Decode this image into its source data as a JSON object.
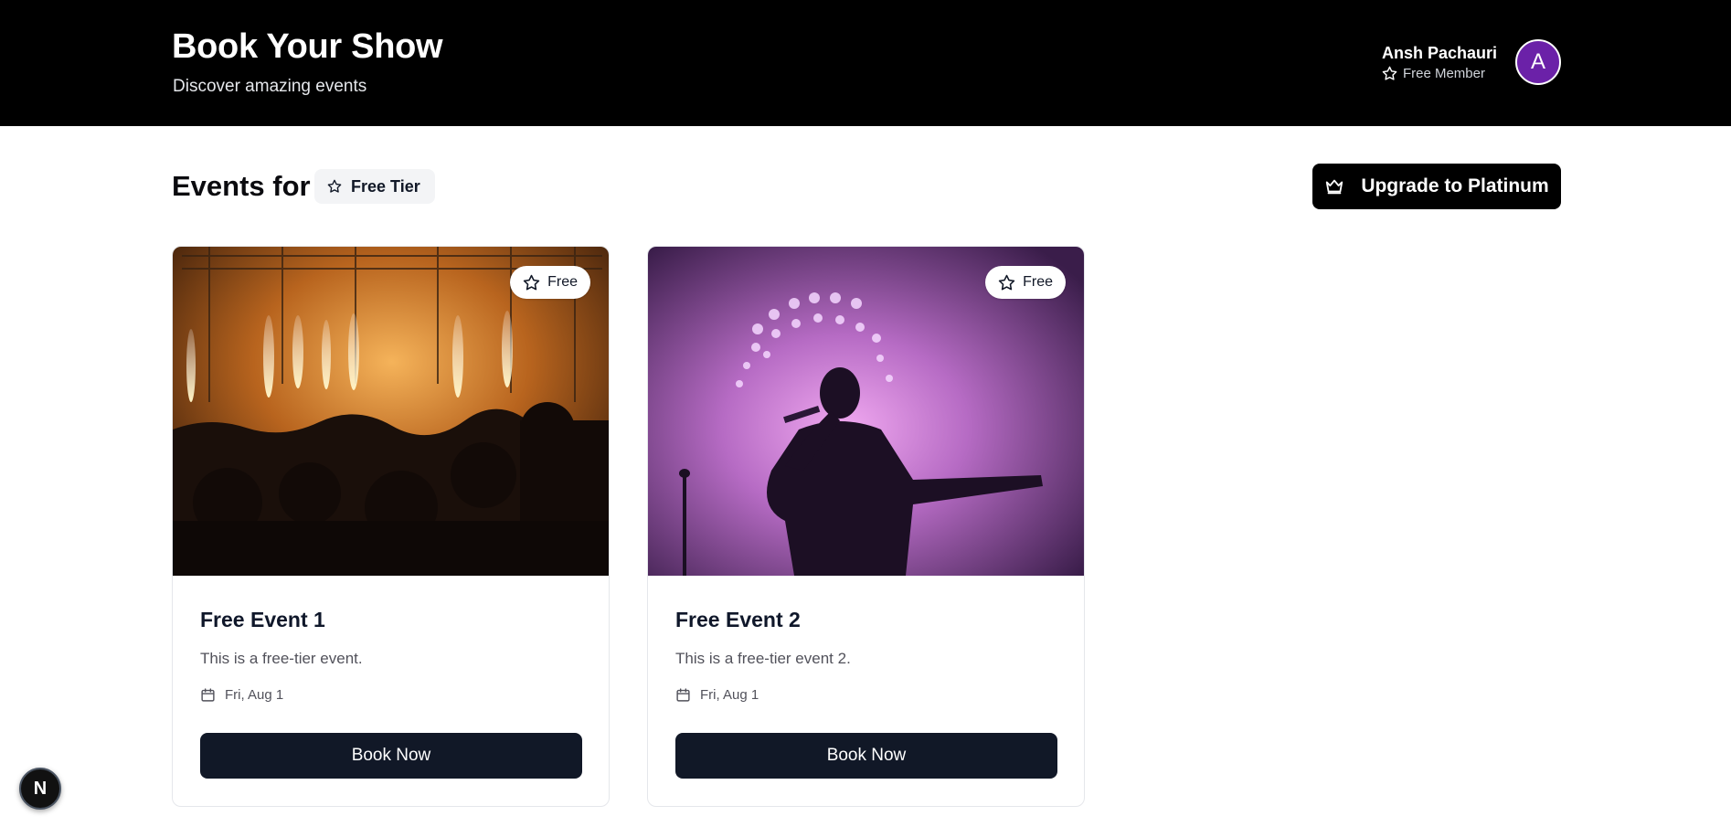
{
  "header": {
    "title": "Book Your Show",
    "subtitle": "Discover amazing events",
    "user_name": "Ansh Pachauri",
    "user_tier": "Free Member",
    "avatar_initial": "A",
    "avatar_color": "#6b21a8"
  },
  "section": {
    "title": "Events for",
    "tier_badge": "Free Tier",
    "upgrade_label": "Upgrade to Platinum"
  },
  "events": [
    {
      "title": "Free Event 1",
      "description": "This is a free-tier event.",
      "date": "Fri, Aug 1",
      "badge": "Free",
      "button": "Book Now",
      "image": "concert-crowd-fireworks"
    },
    {
      "title": "Free Event 2",
      "description": "This is a free-tier event 2.",
      "date": "Fri, Aug 1",
      "badge": "Free",
      "button": "Book Now",
      "image": "singer-silhouette-purple"
    }
  ],
  "dev_badge": "N",
  "colors": {
    "header_bg": "#000000",
    "button_dark": "#111827",
    "accent_purple": "#6b21a8"
  },
  "icons": [
    "star-icon",
    "crown-icon",
    "calendar-icon"
  ]
}
